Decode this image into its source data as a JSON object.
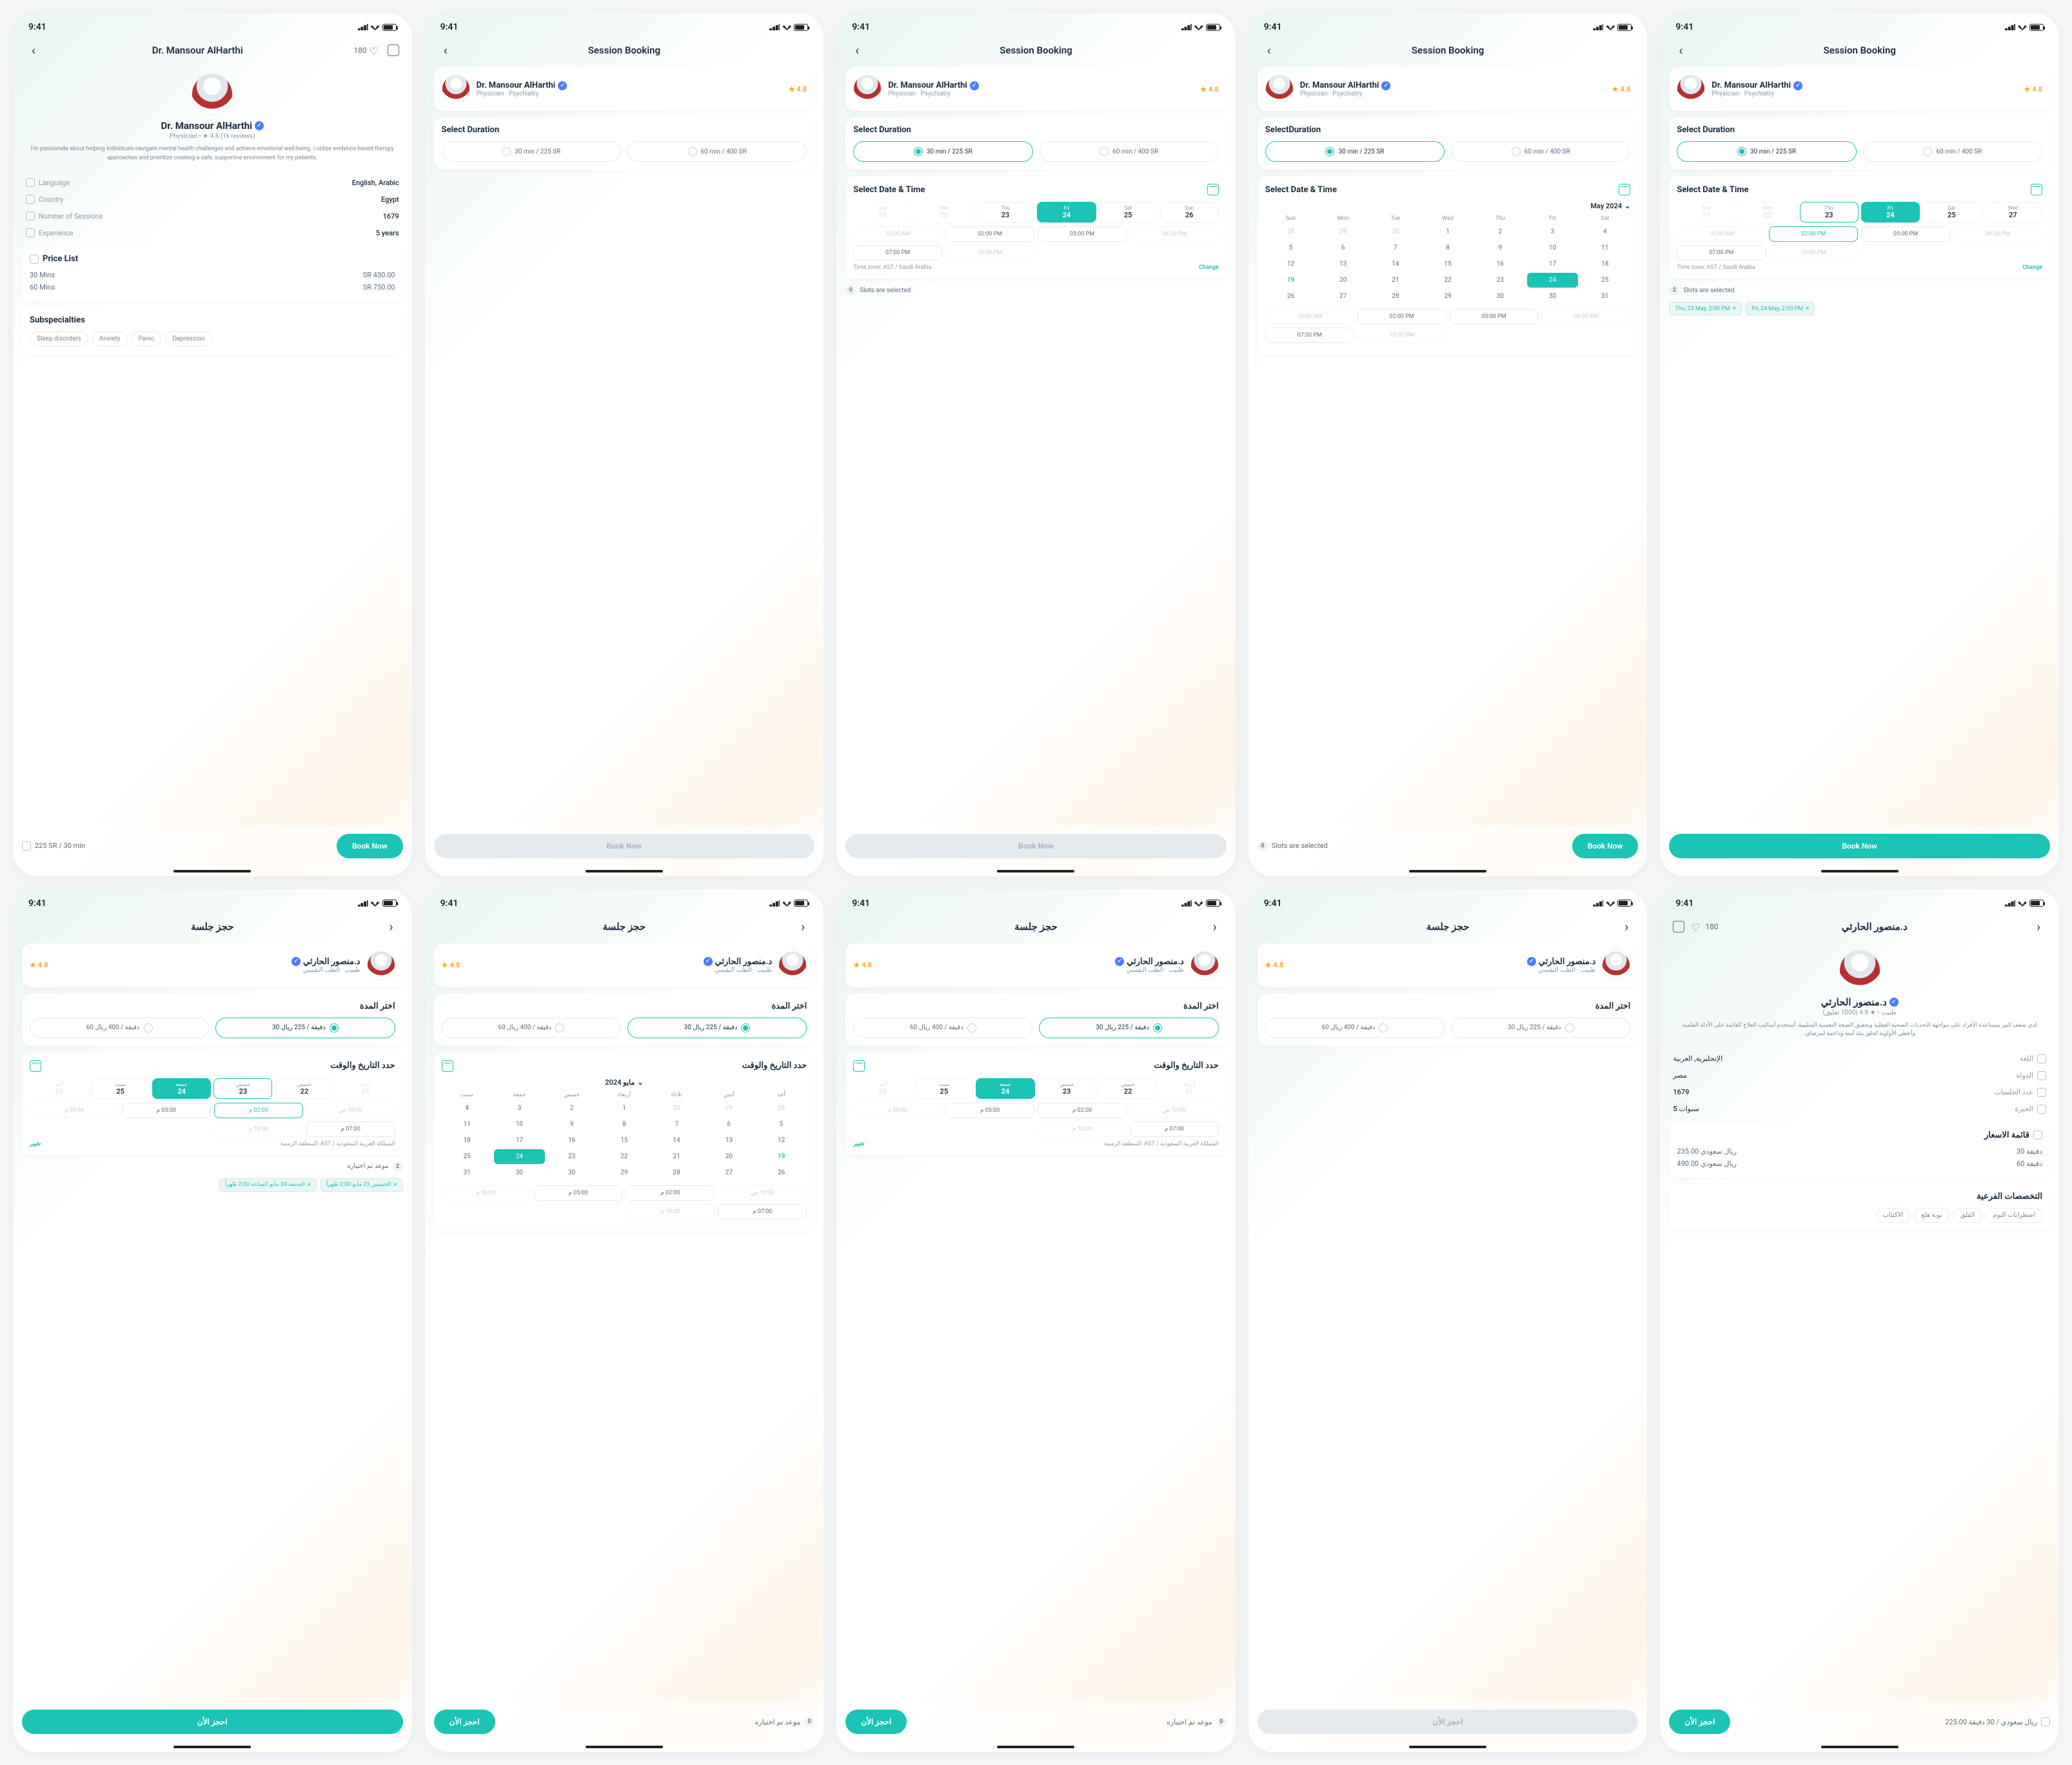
{
  "status": {
    "time": "9:41"
  },
  "en": {
    "profile_title": "Dr. Mansour AlHarthi",
    "likes": "180",
    "name": "Dr. Mansour AlHarthi",
    "role": "Physician",
    "spec": "Psychiatry",
    "rating": "4.8",
    "reviews": "(1k reviews)",
    "sub_line": "Physician  •  ★ 4.8 (1k reviews)",
    "bio": "I'm passionate about helping individuals navigate mental health challenges and achieve emotional well-being. I utilize evidence-based therapy approaches and prioritize creating a safe, supportive environment for my patients.",
    "info": {
      "language": {
        "label": "Language",
        "value": "English, Arabic"
      },
      "country": {
        "label": "Country",
        "value": "Egypt"
      },
      "sessions": {
        "label": "Number of Sessions",
        "value": "1679"
      },
      "experience": {
        "label": "Experience",
        "value": "5 years"
      }
    },
    "price_title": "Price List",
    "prices": [
      {
        "label": "30 Mins",
        "value": "SR 450.00"
      },
      {
        "label": "60 Mins",
        "value": "SR 750.00"
      }
    ],
    "subspec_title": "Subspecialties",
    "subspec": [
      "Sleep disorders",
      "Anxiety",
      "Panic",
      "Depression"
    ],
    "footer_price": "225 SR / 30 min",
    "book_now": "Book Now",
    "booking_title": "Session Booking",
    "select_duration": "Select Duration",
    "select_duration_alt": "SelectDuration",
    "dur_30": "30 min / 225 SR",
    "dur_60": "60 min / 400 SR",
    "select_dt": "Select Date & Time",
    "days": [
      {
        "n": "Tue",
        "d": "21"
      },
      {
        "n": "Wed",
        "d": "22"
      },
      {
        "n": "Thu",
        "d": "23"
      },
      {
        "n": "Fri",
        "d": "24"
      },
      {
        "n": "Sat",
        "d": "25"
      },
      {
        "n": "Sun",
        "d": "26"
      }
    ],
    "days2": [
      {
        "n": "Tue",
        "d": "21"
      },
      {
        "n": "Wed",
        "d": "22"
      },
      {
        "n": "Thu",
        "d": "23"
      },
      {
        "n": "Fri",
        "d": "24"
      },
      {
        "n": "Sat",
        "d": "25"
      },
      {
        "n": "Wed",
        "d": "27"
      }
    ],
    "times": [
      "10:00 AM",
      "02:00 PM",
      "05:00 PM",
      "06:00 PM",
      "07:00 PM",
      "10:00 PM"
    ],
    "tz": "Time zone: AST / Saudi Arabia",
    "change": "Change",
    "slots_sel": "Slots are selected",
    "month": "May 2024",
    "dow": [
      "Sun",
      "Mon",
      "Tue",
      "Wed",
      "Thu",
      "Fri",
      "Sat"
    ],
    "cal": [
      {
        "d": "28",
        "o": 1
      },
      {
        "d": "29",
        "o": 1
      },
      {
        "d": "30",
        "o": 1
      },
      {
        "d": "1"
      },
      {
        "d": "2"
      },
      {
        "d": "3"
      },
      {
        "d": "4"
      },
      {
        "d": "5"
      },
      {
        "d": "6"
      },
      {
        "d": "7"
      },
      {
        "d": "8"
      },
      {
        "d": "9"
      },
      {
        "d": "10"
      },
      {
        "d": "11"
      },
      {
        "d": "12"
      },
      {
        "d": "13"
      },
      {
        "d": "14"
      },
      {
        "d": "15"
      },
      {
        "d": "16"
      },
      {
        "d": "17"
      },
      {
        "d": "18"
      },
      {
        "d": "19",
        "hl": 1
      },
      {
        "d": "20"
      },
      {
        "d": "21"
      },
      {
        "d": "22"
      },
      {
        "d": "23"
      },
      {
        "d": "24",
        "sel": 1
      },
      {
        "d": "25"
      },
      {
        "d": "26"
      },
      {
        "d": "27"
      },
      {
        "d": "28"
      },
      {
        "d": "29"
      },
      {
        "d": "30"
      },
      {
        "d": "30"
      },
      {
        "d": "31"
      }
    ],
    "chips": [
      "Thu, 23 May, 2:00 PM",
      "Fri, 24 May, 2:00 PM"
    ]
  },
  "ar": {
    "profile_title": "د.منصور الحارثي",
    "likes": "180",
    "name": "د.منصور الحارثي",
    "role": "طبيب",
    "spec": "الطب النفسي",
    "rating": "4.8",
    "sub_line": "طبيب • ★ 4.8 (1000 تعليق)",
    "bio": "لدي شغف كبير بمساعدة الأفراد على مواجهة التحديات الصحية العقلية وتحقيق الصحة النفسية السليمة. أستخدم أساليب العلاج القائمة على الأدلة العلمية وأعطي الأولوية لخلق بيئة آمنة وداعمة لمرضاي.",
    "info": {
      "language": {
        "label": "اللغة",
        "value": "الإنجليزية, العربية"
      },
      "country": {
        "label": "الدولة",
        "value": "مصر"
      },
      "sessions": {
        "label": "عدد الجلسات",
        "value": "1679"
      },
      "experience": {
        "label": "الخبرة",
        "value": "5 سنوات"
      }
    },
    "price_title": "قائمة الاسعار",
    "prices": [
      {
        "label": "30 دقيقة",
        "value": "235.00 ريال سعودي"
      },
      {
        "label": "60 دقيقة",
        "value": "490.00 ريال سعودي"
      }
    ],
    "subspec_title": "التخصصات الفرعية",
    "subspec": [
      "اضطرابات النوم",
      "القلق",
      "نوبة هلع",
      "الاكتئاب"
    ],
    "footer_price": "225.00 ريال سعودي / 30 دقيقة",
    "book_now": "احجز الأن",
    "booking_title": "حجز جلسة",
    "select_duration": "اختر المدة",
    "dur_30": "30 دقيقة / 225 ريال",
    "dur_60": "60 دقيقة / 400 ريال",
    "select_dt": "حدد التاريخ والوقت",
    "days": [
      {
        "n": "أربعاء",
        "d": "21"
      },
      {
        "n": "خميس",
        "d": "22"
      },
      {
        "n": "خميس",
        "d": "23"
      },
      {
        "n": "جمعة",
        "d": "24"
      },
      {
        "n": "سبت",
        "d": "25"
      },
      {
        "n": "أحد",
        "d": "26"
      }
    ],
    "times": [
      "10:00 ص",
      "02:00 م",
      "05:00 م",
      "06:00 م",
      "07:00 م",
      "10:00 م"
    ],
    "tz": "المنطقة الزمنية: AST / المملكة العربية السعودية",
    "change": "تغيير",
    "slots_sel": "موعد تم اختياره",
    "month": "مايو 2024",
    "dow": [
      "أحد",
      "أثنين",
      "ثلاثاء",
      "أربعاء",
      "خميس",
      "جمعة",
      "سبت"
    ],
    "chips": [
      "الخميس 23 مايو 2:00 ظهراً",
      "الجمعة 24 مايو الساعة 2:00 ظهراً"
    ]
  }
}
